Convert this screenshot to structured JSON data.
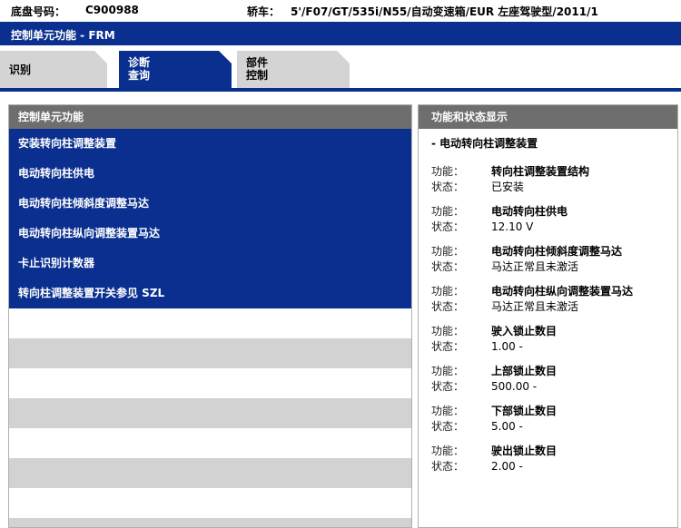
{
  "header": {
    "chassis_label": "底盘号码：",
    "chassis_value": "C900988",
    "vehicle_label": "轿车：",
    "vehicle_value": "5'/F07/GT/535i/N55/自动变速箱/EUR 左座驾驶型/2011/1"
  },
  "window_title": "控制单元功能 - FRM",
  "tabs": [
    {
      "line1": "识别",
      "line2": ""
    },
    {
      "line1": "诊断",
      "line2": "查询"
    },
    {
      "line1": "部件",
      "line2": "控制"
    }
  ],
  "left_panel": {
    "title": "控制单元功能",
    "items": [
      "安装转向柱调整装置",
      "电动转向柱供电",
      "电动转向柱倾斜度调整马达",
      "电动转向柱纵向调整装置马达",
      "卡止识别计数器",
      "转向柱调整装置开关参见 SZL"
    ]
  },
  "right_panel": {
    "title": "功能和状态显示",
    "subtitle": "- 电动转向柱调整装置",
    "func_key": "功能：",
    "status_key": "状态：",
    "entries": [
      {
        "func": "转向柱调整装置结构",
        "status": "已安装"
      },
      {
        "func": "电动转向柱供电",
        "status": "12.10 V"
      },
      {
        "func": "电动转向柱倾斜度调整马达",
        "status": "马达正常且未激活"
      },
      {
        "func": "电动转向柱纵向调整装置马达",
        "status": "马达正常且未激活"
      },
      {
        "func": "驶入锁止数目",
        "status": "1.00 -"
      },
      {
        "func": "上部锁止数目",
        "status": "500.00 -"
      },
      {
        "func": "下部锁止数目",
        "status": "5.00 -"
      },
      {
        "func": "驶出锁止数目",
        "status": "2.00 -"
      }
    ]
  }
}
